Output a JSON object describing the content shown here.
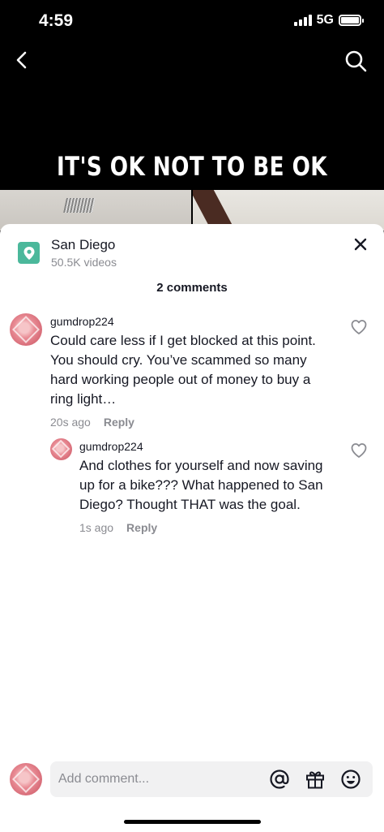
{
  "status_bar": {
    "time": "4:59",
    "network": "5G"
  },
  "video": {
    "overlay_text": "IT'S OK NOT TO BE OK"
  },
  "location": {
    "name": "San Diego",
    "videos": "50.5K videos",
    "icon": "location-pin-icon"
  },
  "comments_header": "2 comments",
  "comments": [
    {
      "username": "gumdrop224",
      "text": "Could care less if I get blocked at this point. You should cry. You’ve scammed so many hard working people out of money to buy a ring light…",
      "time": "20s ago",
      "reply_label": "Reply"
    },
    {
      "username": "gumdrop224",
      "text": "And clothes for yourself and now saving up for a bike??? What happened to San Diego? Thought THAT was the goal.",
      "time": "1s ago",
      "reply_label": "Reply"
    }
  ],
  "composer": {
    "placeholder": "Add comment..."
  },
  "colors": {
    "accent_location": "#4bb89b",
    "text_primary": "#161823",
    "text_secondary": "#8a8b91"
  }
}
